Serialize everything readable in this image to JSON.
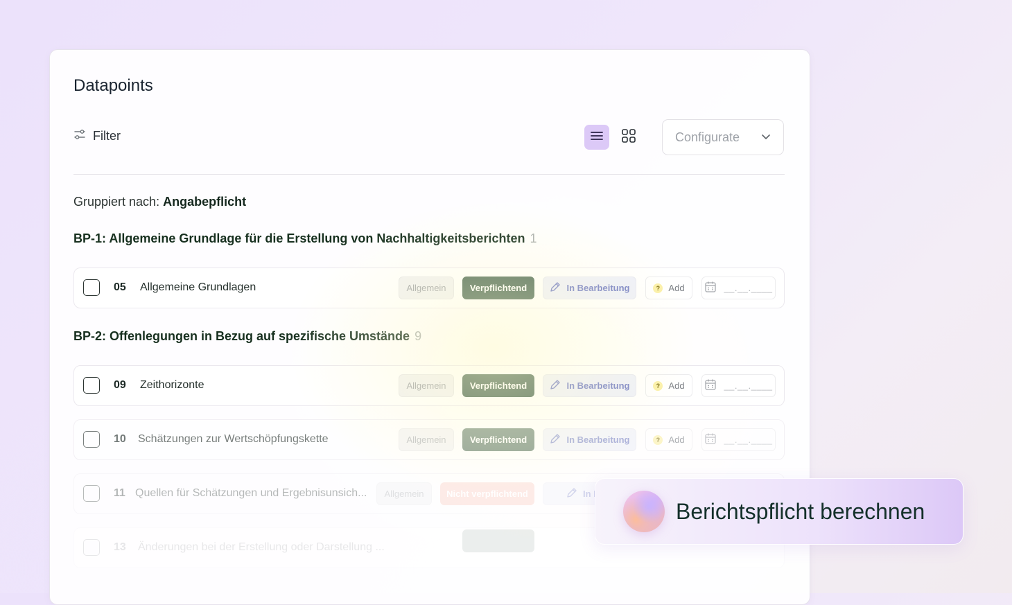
{
  "page": {
    "title": "Datapoints"
  },
  "toolbar": {
    "filter_label": "Filter",
    "list_view_icon": "list-icon",
    "grid_view_icon": "grid-icon",
    "configurate_label": "Configurate",
    "active_view": "list"
  },
  "grouping": {
    "prefix": "Gruppiert nach:",
    "value": "Angabepflicht"
  },
  "groups": [
    {
      "title": "BP-1: Allgemeine Grundlage für die Erstellung von Nachhaltigkeitsberichten",
      "count": "1"
    },
    {
      "title": "BP-2: Offenlegungen in Bezug auf spezifische Umstände",
      "count": "9"
    }
  ],
  "rows": [
    {
      "num": "05",
      "name": "Allgemeine Grundlagen",
      "category": "Allgemein",
      "requirement": "Verpflichtend",
      "status": "In Bearbeitung",
      "add": "Add",
      "date": "__.__.____"
    },
    {
      "num": "09",
      "name": "Zeithorizonte",
      "category": "Allgemein",
      "requirement": "Verpflichtend",
      "status": "In Bearbeitung",
      "add": "Add",
      "date": "__.__.____"
    },
    {
      "num": "10",
      "name": "Schätzungen zur Wertschöpfungskette",
      "category": "Allgemein",
      "requirement": "Verpflichtend",
      "status": "In Bearbeitung",
      "add": "Add",
      "date": "__.__.____"
    },
    {
      "num": "11",
      "name": "Quellen für Schätzungen und Ergebnisunsich...",
      "category": "Allgemein",
      "requirement": "Nicht verpflichtend",
      "status": "In Bear"
    },
    {
      "num": "13",
      "name": "Änderungen bei der Erstellung oder Darstellung ..."
    }
  ],
  "colors": {
    "required_green": "#4e6b57",
    "not_required_salmon": "#f9c6bb",
    "status_blue": "#7680c6",
    "accent_purple": "#dcc9f7"
  },
  "toast": {
    "label": "Berichtspflicht berechnen"
  }
}
